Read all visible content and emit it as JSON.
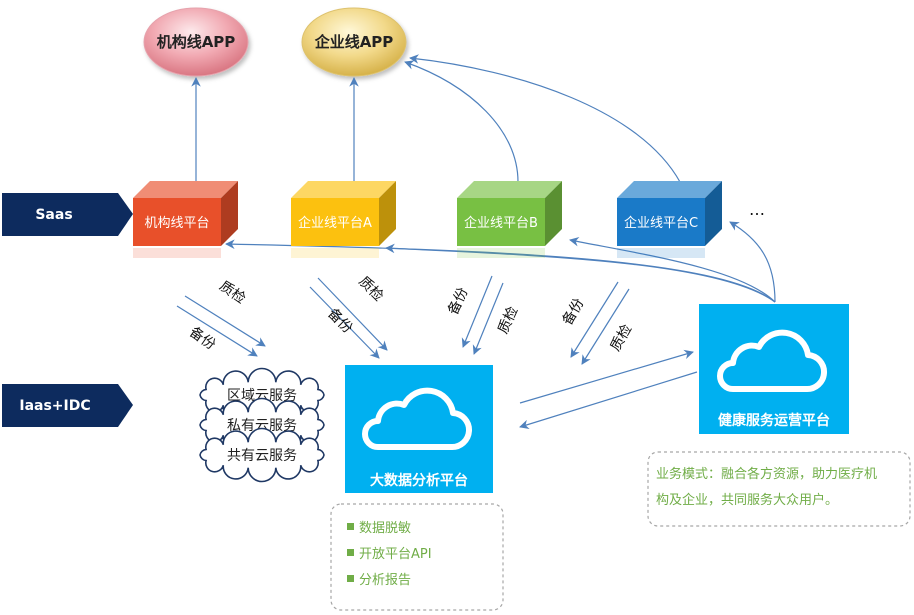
{
  "apps": {
    "institution": "机构线APP",
    "enterprise": "企业线APP"
  },
  "layers": {
    "saas": "Saas",
    "iaas": "Iaas+IDC"
  },
  "platforms": [
    {
      "label": "机构线平台",
      "color": "#e8502a"
    },
    {
      "label": "企业线平台A",
      "color": "#fcc10f"
    },
    {
      "label": "企业线平台B",
      "color": "#78c043"
    },
    {
      "label": "企业线平台C",
      "color": "#1a7ac8"
    }
  ],
  "more": "…",
  "edge_labels": {
    "qc": "质检",
    "backup": "备份"
  },
  "cloud_services": [
    "区域云服务",
    "私有云服务",
    "共有云服务"
  ],
  "bigdata": {
    "label": "大数据分析平台",
    "features": [
      "数据脱敏",
      "开放平台API",
      "分析报告"
    ]
  },
  "health": {
    "label": "健康服务运营平台",
    "note_line1": "业务模式：融合各方资源，助力医疗机",
    "note_line2": "构及企业，共同服务大众用户。"
  },
  "colors": {
    "arrow": "#4f81bd",
    "navy": "#0d2b5e",
    "sky": "#00b0f0",
    "green_text": "#70ad47"
  }
}
